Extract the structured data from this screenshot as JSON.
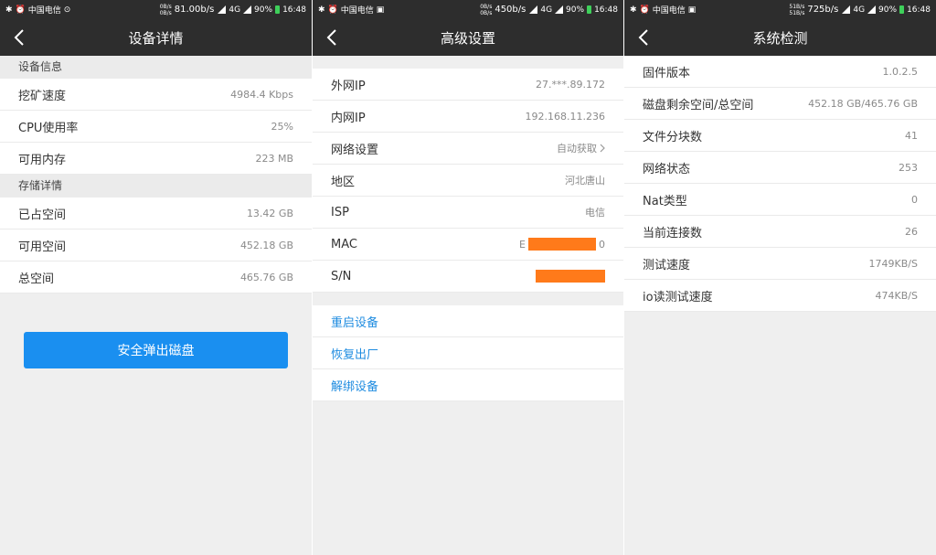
{
  "status": {
    "left": [
      {
        "carrier": "中国电信"
      },
      {
        "carrier": "中国电信"
      },
      {
        "carrier": "中国电信"
      }
    ],
    "speeds": [
      {
        "up": "0B/s",
        "down": "0B/s",
        "big": "81.00b/s"
      },
      {
        "up": "0B/s",
        "down": "0B/s",
        "big": "450b/s"
      },
      {
        "up": "51B/s",
        "down": "51B/s",
        "big": "725b/s"
      }
    ],
    "network": "4G",
    "battery": "90%",
    "time": "16:48",
    "battery_color": "#3ed05a"
  },
  "screen1": {
    "title": "设备详情",
    "section_device": "设备信息",
    "device_rows": [
      {
        "label": "挖矿速度",
        "value": "4984.4 Kbps"
      },
      {
        "label": "CPU使用率",
        "value": "25%"
      },
      {
        "label": "可用内存",
        "value": "223 MB"
      }
    ],
    "section_storage": "存储详情",
    "storage_rows": [
      {
        "label": "已占空间",
        "value": "13.42 GB"
      },
      {
        "label": "可用空间",
        "value": "452.18 GB"
      },
      {
        "label": "总空间",
        "value": "465.76 GB"
      }
    ],
    "eject_label": "安全弹出磁盘"
  },
  "screen2": {
    "title": "高级设置",
    "rows": [
      {
        "label": "外网IP",
        "value": "27.***.89.172"
      },
      {
        "label": "内网IP",
        "value": "192.168.11.236"
      },
      {
        "label": "网络设置",
        "value": "自动获取"
      },
      {
        "label": "地区",
        "value": "河北唐山"
      },
      {
        "label": "ISP",
        "value": "电信"
      },
      {
        "label": "MAC",
        "value_prefix": "E",
        "value_suffix": "0"
      },
      {
        "label": "S/N",
        "value_prefix": "",
        "value_suffix": ""
      }
    ],
    "actions": [
      "重启设备",
      "恢复出厂",
      "解绑设备"
    ],
    "redaction_color": "#ff7a1a"
  },
  "screen3": {
    "title": "系统检测",
    "rows": [
      {
        "label": "固件版本",
        "value": "1.0.2.5"
      },
      {
        "label": "磁盘剩余空间/总空间",
        "value": "452.18 GB/465.76 GB"
      },
      {
        "label": "文件分块数",
        "value": "41"
      },
      {
        "label": "网络状态",
        "value": "253"
      },
      {
        "label": "Nat类型",
        "value": "0"
      },
      {
        "label": "当前连接数",
        "value": "26"
      },
      {
        "label": "测试速度",
        "value": "1749KB/S"
      },
      {
        "label": "io读测试速度",
        "value": "474KB/S"
      }
    ]
  },
  "icons": {
    "back": "back-arrow-icon",
    "chevron": "chevron-right-icon"
  },
  "colors": {
    "nav_bg": "#2d2d2d",
    "accent": "#1a8ff0",
    "action_text": "#1f8ce0"
  }
}
